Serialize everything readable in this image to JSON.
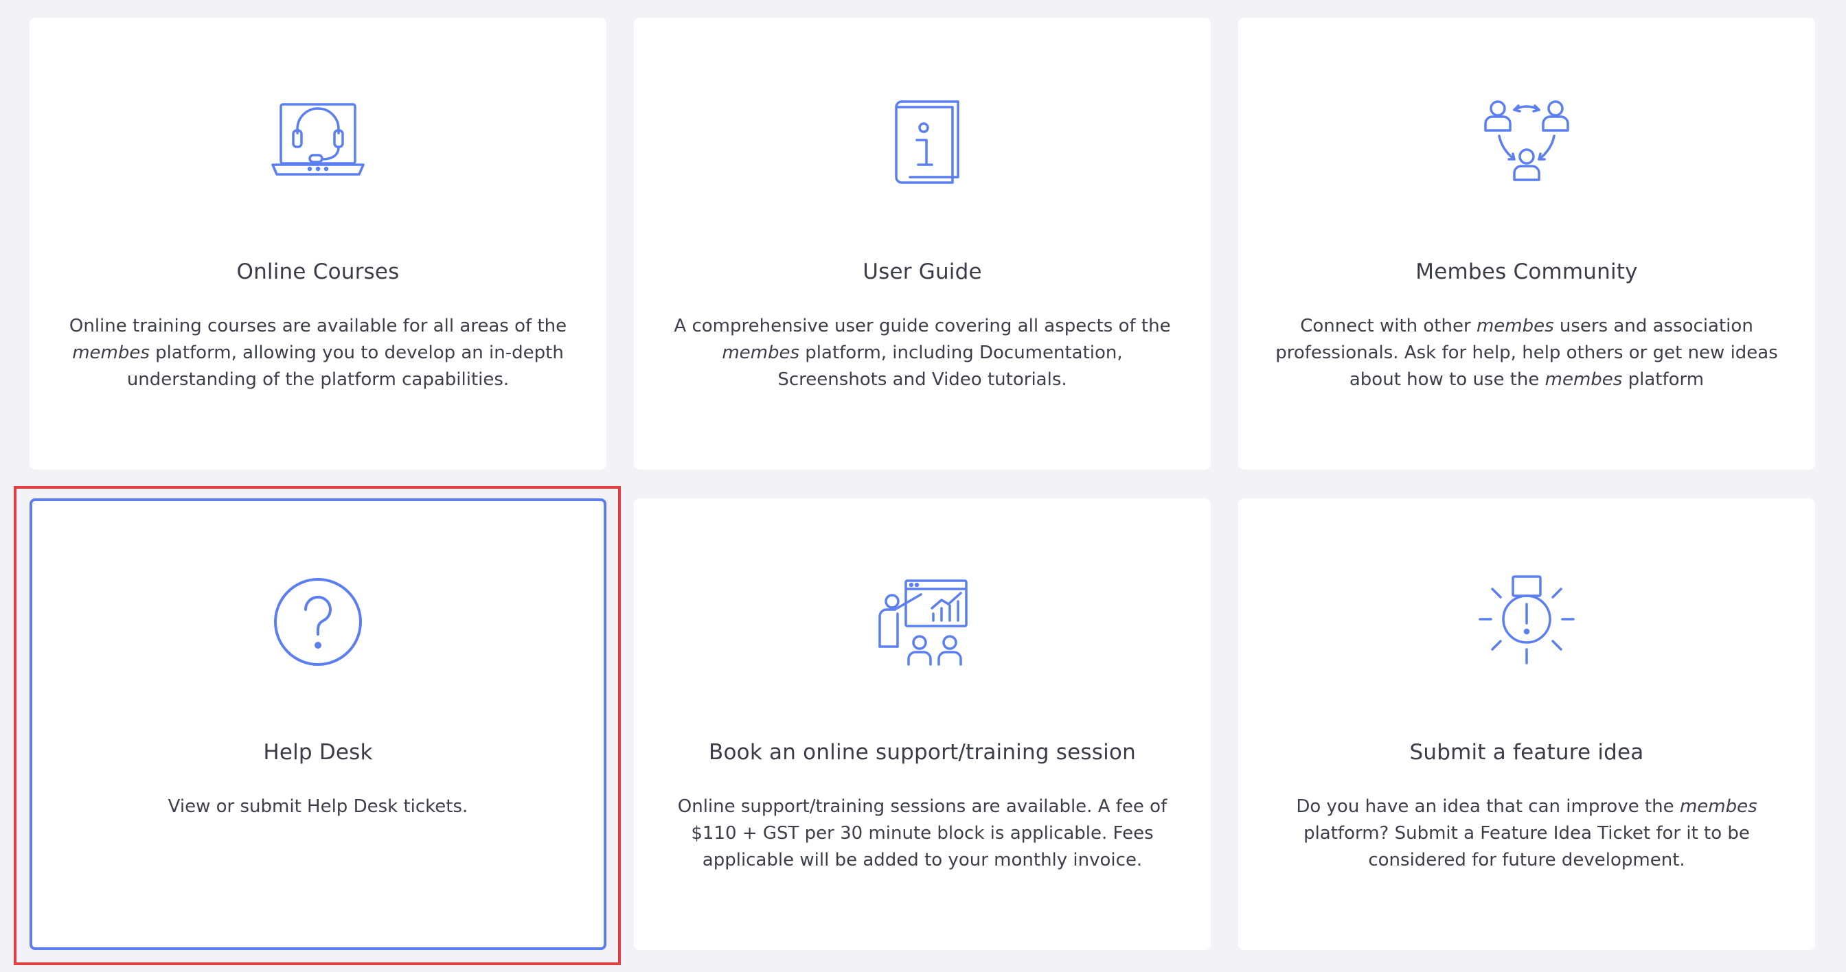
{
  "cards": [
    {
      "title": "Online Courses",
      "icon": "headset-laptop-icon",
      "desc_before": "Online training courses are available for all areas of the ",
      "desc_em": "membes",
      "desc_after": " platform, allowing you to develop an in-depth understanding of the platform capabilities."
    },
    {
      "title": "User Guide",
      "icon": "info-book-icon",
      "desc_before": "A comprehensive user guide covering all aspects of the ",
      "desc_em": "membes",
      "desc_after": " platform, including Documentation, Screenshots and Video tutorials."
    },
    {
      "title": "Membes Community",
      "icon": "community-network-icon",
      "desc_before": "Connect with other ",
      "desc_em": "membes",
      "desc_mid": " users and association professionals. Ask for help, help others or get new ideas about how to use the ",
      "desc_em2": "membes",
      "desc_after": " platform"
    },
    {
      "title": "Help Desk",
      "icon": "question-circle-icon",
      "desc": "View or submit Help Desk tickets."
    },
    {
      "title": "Book an online support/training session",
      "icon": "presentation-training-icon",
      "desc": "Online support/training sessions are available. A fee of $110 + GST per 30 minute block is applicable. Fees applicable will be added to your monthly invoice."
    },
    {
      "title": "Submit a feature idea",
      "icon": "idea-bulb-icon",
      "desc_before": "Do you have an idea that can improve the ",
      "desc_em": "membes",
      "desc_after": " platform? Submit a Feature Idea Ticket for it to be considered for future development."
    }
  ],
  "colors": {
    "accent": "#5b7ff0",
    "highlight": "#e04040",
    "background": "#f3f3f7",
    "card": "#ffffff",
    "text": "#3c3f4a"
  }
}
